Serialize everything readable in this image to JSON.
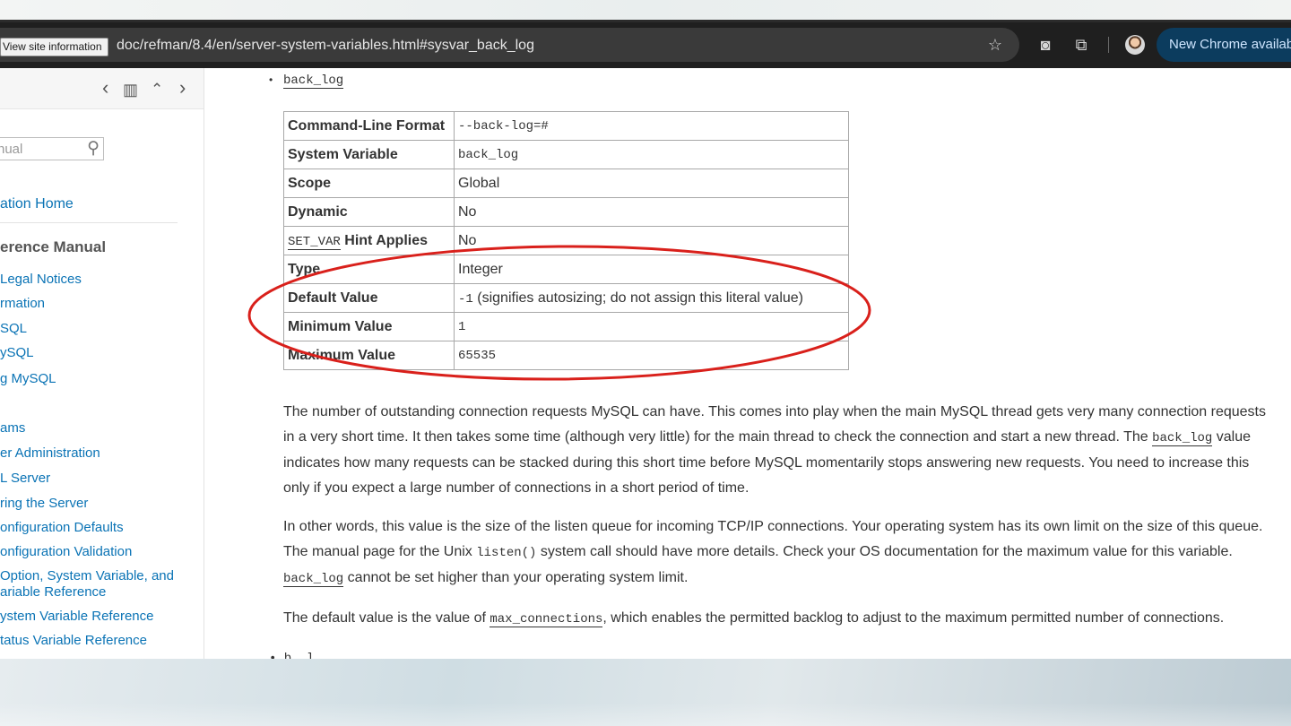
{
  "browser": {
    "site_info_label": "View site information",
    "url": "doc/refman/8.4/en/server-system-variables.html#sysvar_back_log",
    "update_button": "New Chrome availab",
    "icons": [
      "star-icon",
      "camera-icon",
      "extensions-icon",
      "profile-avatar"
    ]
  },
  "sidebar": {
    "search_placeholder": "nual",
    "home_link": "ation Home",
    "section_title": "erence Manual",
    "items": [
      "Legal Notices",
      "rmation",
      "SQL",
      "ySQL",
      "g MySQL",
      "ams",
      "er Administration",
      "L Server",
      "ring the Server",
      "onfiguration Defaults",
      "onfiguration Validation",
      "Option, System Variable, and",
      "ariable Reference",
      "ystem Variable Reference",
      "tatus Variable Reference"
    ]
  },
  "main": {
    "variable": "back_log",
    "table": [
      {
        "label": "Command-Line Format",
        "value": "--back-log=#"
      },
      {
        "label": "System Variable",
        "value": "back_log"
      },
      {
        "label": "Scope",
        "value": "Global"
      },
      {
        "label": "Dynamic",
        "value": "No"
      },
      {
        "label_code": "SET_VAR",
        "label": "Hint Applies",
        "value": "No"
      },
      {
        "label": "Type",
        "value": "Integer"
      },
      {
        "label": "Default Value",
        "value_code": "-1",
        "value": "(signifies autosizing; do not assign this literal value)"
      },
      {
        "label": "Minimum Value",
        "value": "1"
      },
      {
        "label": "Maximum Value",
        "value": "65535"
      }
    ],
    "p1": {
      "a": "The number of outstanding connection requests MySQL can have. This comes into play when the main MySQL thread gets very many connection requests in a very short time. It then takes some time (although very little) for the main thread to check the connection and start a new thread. The ",
      "code": "back_log",
      "b": " value indicates how many requests can be stacked during this short time before MySQL momentarily stops answering new requests. You need to increase this only if you expect a large number of connections in a short period of time."
    },
    "p2": {
      "a": "In other words, this value is the size of the listen queue for incoming TCP/IP connections. Your operating system has its own limit on the size of this queue. The manual page for the Unix ",
      "code1": "listen()",
      "b": " system call should have more details. Check your OS documentation for the maximum value for this variable. ",
      "code2": "back_log",
      "c": " cannot be set higher than your operating system limit."
    },
    "p3": {
      "a": "The default value is the value of ",
      "code": "max_connections",
      "b": ", which enables the permitted backlog to adjust to the maximum permitted number of connections."
    },
    "next_item": "• b_  l"
  },
  "colors": {
    "annotation_ellipse": "#d9201b",
    "link_blue": "#0a73b5",
    "update_button_bg": "#0c3c5e"
  }
}
